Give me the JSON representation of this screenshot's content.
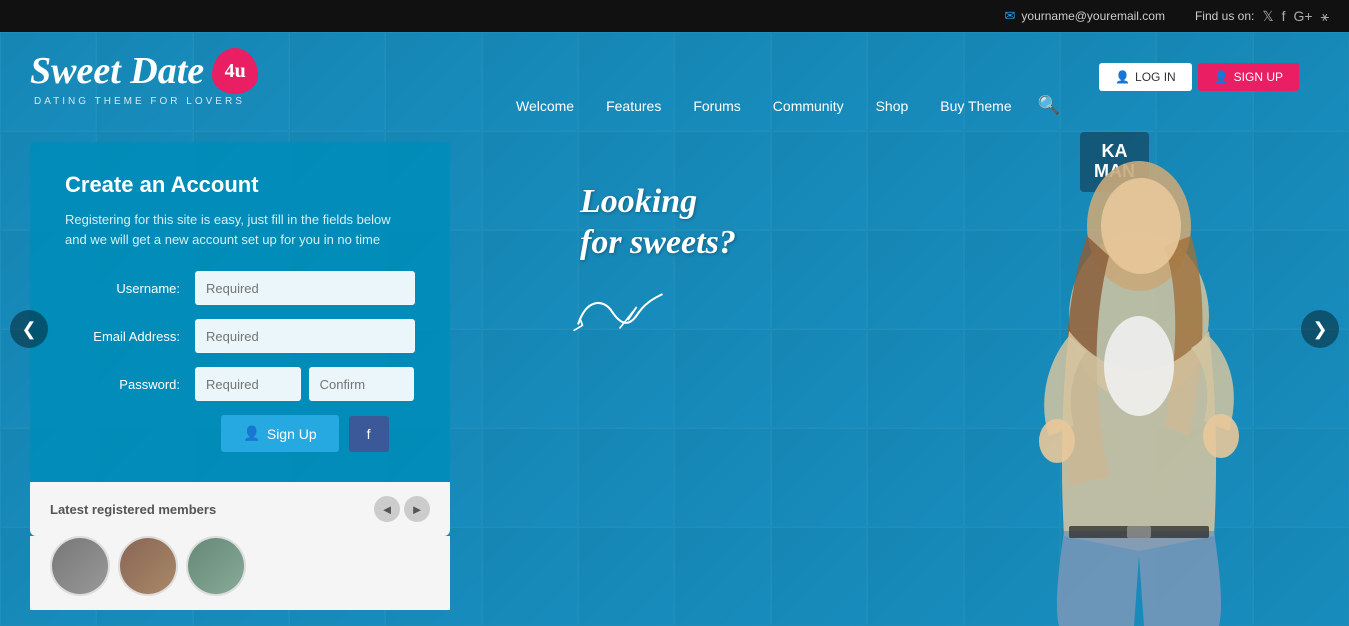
{
  "topbar": {
    "email": "yourname@youremail.com",
    "find_us_label": "Find us on:",
    "email_icon": "✉",
    "twitter_icon": "𝕋",
    "facebook_icon": "f",
    "googleplus_icon": "G+",
    "pinterest_icon": "P"
  },
  "logo": {
    "brand": "Sweet Date",
    "suffix": "4u",
    "tagline": "DATING THEME FOR LOVERS"
  },
  "nav": {
    "items": [
      {
        "label": "Welcome",
        "id": "welcome"
      },
      {
        "label": "Features",
        "id": "features"
      },
      {
        "label": "Forums",
        "id": "forums"
      },
      {
        "label": "Community",
        "id": "community"
      },
      {
        "label": "Shop",
        "id": "shop"
      },
      {
        "label": "Buy Theme",
        "id": "buy-theme"
      }
    ]
  },
  "auth": {
    "login_label": "LOG IN",
    "signup_label": "SIGN UP",
    "login_icon": "👤",
    "signup_icon": "👤"
  },
  "form": {
    "title": "Create an Account",
    "description": "Registering for this site is easy, just fill in the fields below and we will get a new account set up for you in no time",
    "fields": {
      "username_label": "Username:",
      "username_placeholder": "Required",
      "email_label": "Email Address:",
      "email_placeholder": "Required",
      "password_label": "Password:",
      "password_placeholder": "Required",
      "confirm_placeholder": "Confirm"
    },
    "signup_btn": "Sign Up",
    "facebook_btn": "f"
  },
  "members": {
    "label": "Latest registered members",
    "prev_icon": "◄",
    "next_icon": "►"
  },
  "hero": {
    "tagline_line1": "Looking",
    "tagline_line2": "for sweets?",
    "kaman_line1": "KA",
    "kaman_line2": "MAN"
  },
  "slider": {
    "prev_icon": "❮",
    "next_icon": "❯"
  }
}
